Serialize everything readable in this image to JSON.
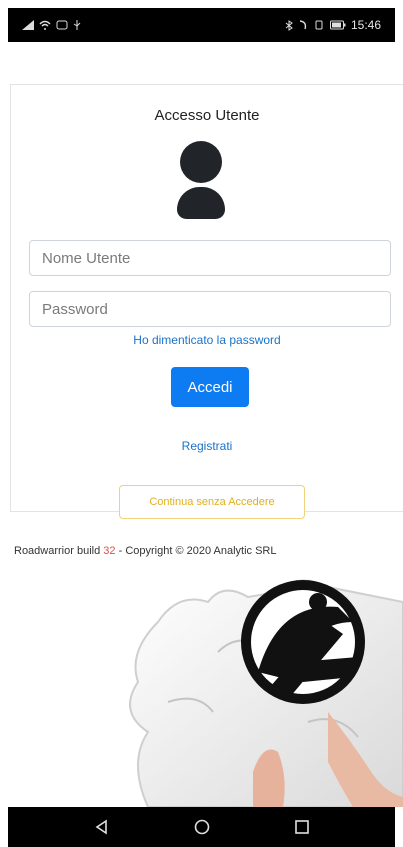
{
  "status_bar": {
    "left_icons": [
      "signal-icon",
      "wifi-icon",
      "notification-icon",
      "usb-icon"
    ],
    "right_icons": [
      "bluetooth-icon",
      "nfc-icon",
      "vibrate-icon",
      "battery-icon"
    ],
    "time": "15:46"
  },
  "login": {
    "title": "Accesso Utente",
    "username_placeholder": "Nome Utente",
    "password_placeholder": "Password",
    "forgot_password": "Ho dimenticato la password",
    "login_button": "Accedi",
    "register_link": "Registrati",
    "guest_button": "Continua senza Accedere"
  },
  "footer": {
    "app_name": "Roadwarrior build",
    "build_number": "32",
    "copyright": "- Copyright © 2020 Analytic SRL"
  },
  "colors": {
    "primary": "#0d7bf2",
    "link": "#1a73c9",
    "warning": "#e0b020",
    "build_number": "#d9534f"
  },
  "nav_bar": {
    "icons": [
      "back-icon",
      "home-icon",
      "recents-icon"
    ]
  }
}
